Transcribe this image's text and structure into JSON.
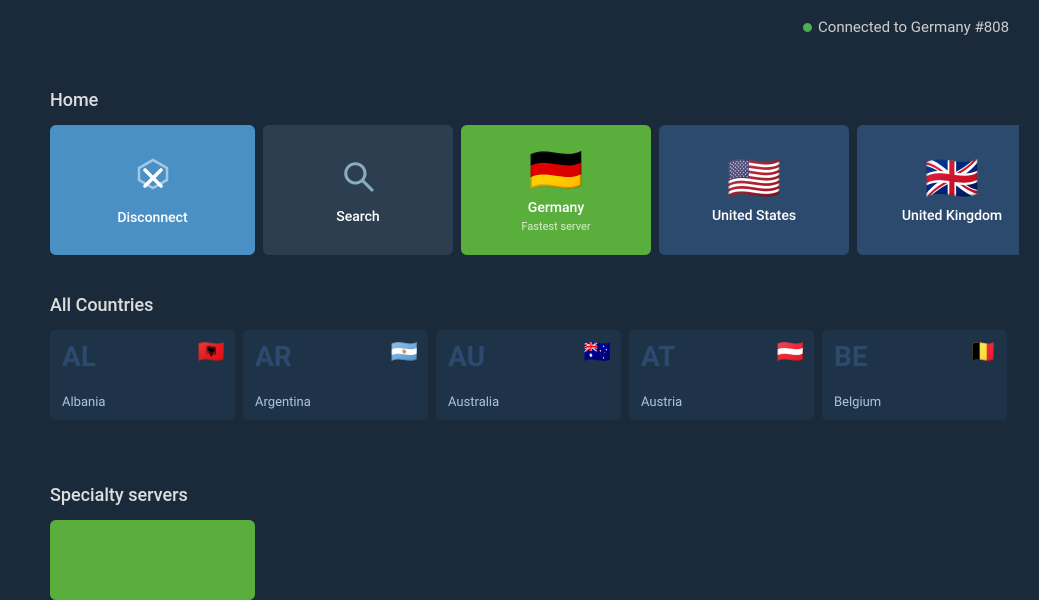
{
  "connection": {
    "status_text": "Connected to Germany #808",
    "dot_color": "#4caf50"
  },
  "home": {
    "section_title": "Home",
    "cards": [
      {
        "id": "disconnect",
        "label": "Disconnect",
        "sublabel": "",
        "type": "disconnect"
      },
      {
        "id": "search",
        "label": "Search",
        "sublabel": "",
        "type": "search"
      },
      {
        "id": "germany",
        "label": "Germany",
        "sublabel": "Fastest server",
        "type": "flag",
        "flag": "🇩🇪"
      },
      {
        "id": "united_states",
        "label": "United States",
        "sublabel": "",
        "type": "flag",
        "flag": "🇺🇸"
      },
      {
        "id": "united_kingdom",
        "label": "United Kingdom",
        "sublabel": "",
        "type": "flag",
        "flag": "🇬🇧"
      }
    ]
  },
  "all_countries": {
    "section_title": "All Countries",
    "cards": [
      {
        "code": "AL",
        "name": "Albania",
        "servers": "",
        "flag": "🇦🇱"
      },
      {
        "code": "AR",
        "name": "Argentina",
        "servers": "",
        "flag": "🇦🇷"
      },
      {
        "code": "AU",
        "name": "Australia",
        "servers": "",
        "flag": "🇦🇺"
      },
      {
        "code": "AT",
        "name": "Austria",
        "servers": "",
        "flag": "🇦🇹"
      },
      {
        "code": "BE",
        "name": "Belgium",
        "servers": "",
        "flag": "🇧🇪"
      }
    ]
  },
  "specialty": {
    "section_title": "Specialty servers"
  }
}
